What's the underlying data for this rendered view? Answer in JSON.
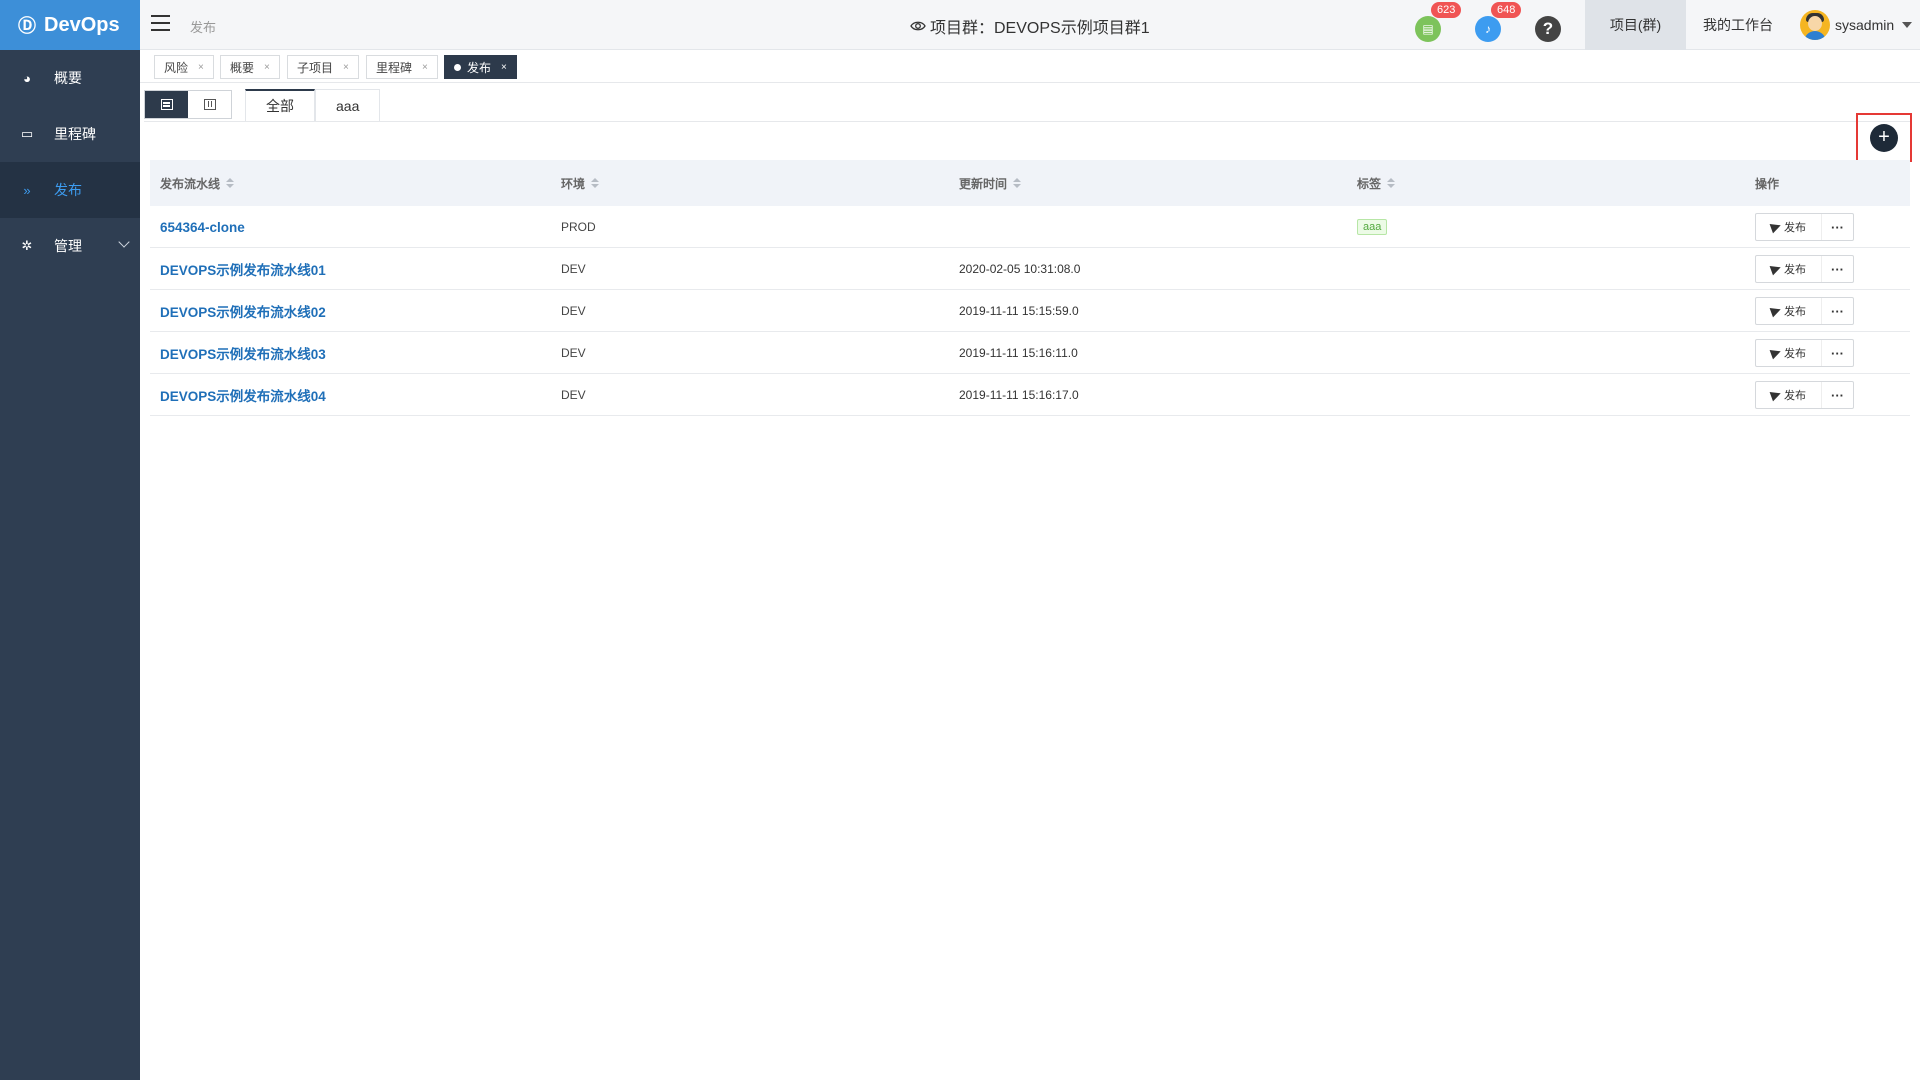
{
  "brand": {
    "name": "DevOps",
    "color": "#3d8fd8"
  },
  "sidebar": {
    "items": [
      {
        "label": "概要",
        "icon": "dashboard-icon",
        "glyph": "◕"
      },
      {
        "label": "里程碑",
        "icon": "folder-icon",
        "glyph": "▭"
      },
      {
        "label": "发布",
        "icon": "forward-icon",
        "glyph": "»",
        "active": true
      },
      {
        "label": "管理",
        "icon": "gear-icon",
        "glyph": "✲",
        "expandable": true
      }
    ]
  },
  "header": {
    "breadcrumb": "发布",
    "title": "项目群：DEVOPS示例项目群1",
    "notifications": [
      {
        "icon": "document-icon",
        "count": "623",
        "color": "#7dc35b"
      },
      {
        "icon": "bell-icon",
        "count": "648",
        "color": "#3d9cf0"
      }
    ],
    "help_glyph": "?",
    "project_group_label": "项目(群)",
    "workspace_label": "我的工作台",
    "username": "sysadmin"
  },
  "tags": [
    {
      "label": "风险"
    },
    {
      "label": "概要"
    },
    {
      "label": "子项目"
    },
    {
      "label": "里程碑"
    },
    {
      "label": "发布",
      "active": true
    }
  ],
  "tag_close": "×",
  "filter_tabs": [
    "全部",
    "aaa"
  ],
  "add_button": "+",
  "table": {
    "columns": [
      "发布流水线",
      "环境",
      "更新时间",
      "标签",
      "操作"
    ],
    "rows": [
      {
        "name": "654364-clone",
        "env": "PROD",
        "time": "",
        "label": "aaa"
      },
      {
        "name": "DEVOPS示例发布流水线01",
        "env": "DEV",
        "time": "2020-02-05 10:31:08.0",
        "label": ""
      },
      {
        "name": "DEVOPS示例发布流水线02",
        "env": "DEV",
        "time": "2019-11-11 15:15:59.0",
        "label": ""
      },
      {
        "name": "DEVOPS示例发布流水线03",
        "env": "DEV",
        "time": "2019-11-11 15:16:11.0",
        "label": ""
      },
      {
        "name": "DEVOPS示例发布流水线04",
        "env": "DEV",
        "time": "2019-11-11 15:16:17.0",
        "label": ""
      }
    ],
    "publish_label": "发布",
    "more_label": "···"
  }
}
